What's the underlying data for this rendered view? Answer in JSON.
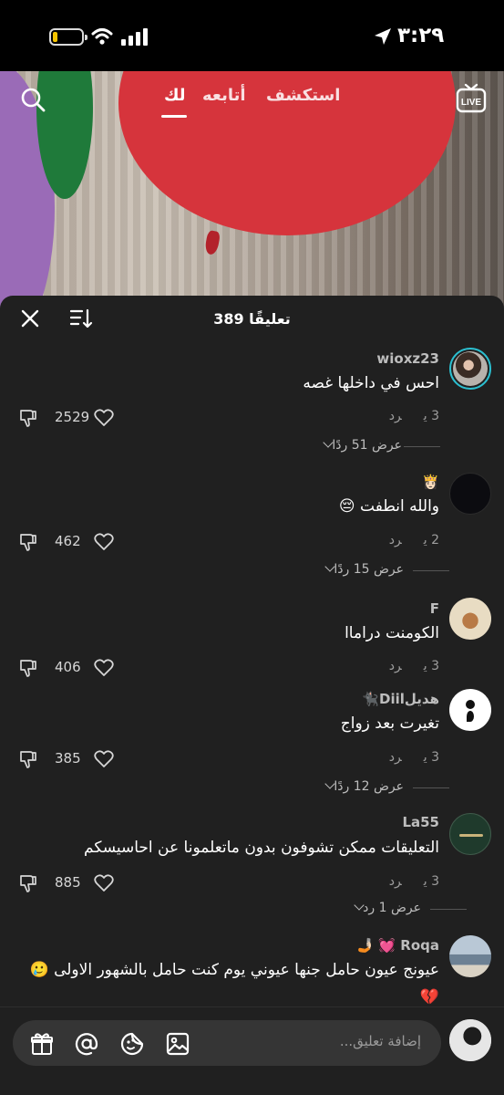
{
  "status_bar": {
    "time": "٣:٢٩",
    "battery_level": 0.15,
    "battery_color": "#f5c400",
    "icons": [
      "battery-icon",
      "wifi-icon",
      "signal-icon",
      "location-arrow-icon"
    ]
  },
  "top_nav": {
    "tabs": [
      {
        "label": "استكشف",
        "active": false
      },
      {
        "label": "أتابعه",
        "active": false
      },
      {
        "label": "لك",
        "active": true
      }
    ],
    "search_icon": "search-icon",
    "live_icon": "LIVE"
  },
  "comments_sheet": {
    "title": "389 تعليقًا",
    "close_icon": "close-icon",
    "sort_icon": "sort-icon",
    "comments": [
      {
        "username": "wioxz23",
        "text": "احس في داخلها غصه",
        "time": "3 ي",
        "reply_label": "رد",
        "likes": "2529",
        "replies_label": "عرض 51 ردًا",
        "avatar_color": "#6a5f56"
      },
      {
        "username": "👸🏻",
        "text": "والله انطفت 😔",
        "time": "2 ي",
        "reply_label": "رد",
        "likes": "462",
        "replies_label": "عرض 15 ردًا",
        "avatar_color": "#0c0c10"
      },
      {
        "username": "F",
        "text": "الكومنت دراماا",
        "time": "3 ي",
        "reply_label": "رد",
        "likes": "406",
        "replies_label": "",
        "avatar_color": "#d8c7a4"
      },
      {
        "username": "هديلDiil🐈‍⬛",
        "text": "تغيرت بعد زواج",
        "time": "3 ي",
        "reply_label": "رد",
        "likes": "385",
        "replies_label": "عرض 12 ردًا",
        "avatar_color": "#ffffff"
      },
      {
        "username": "La55",
        "text": "التعليقات ممكن تشوفون بدون ماتعلمونا عن احاسيسكم",
        "time": "3 ي",
        "reply_label": "رد",
        "likes": "885",
        "replies_label": "عرض 1 رد",
        "avatar_color": "#1f3a2c"
      },
      {
        "username": "Roqa 💓 🤳🏻",
        "text": "عيونج عيون حامل جنها عيوني يوم كنت حامل بالشهور الاولى 🥲💔",
        "avatar_color": "#8fa3b5"
      }
    ]
  },
  "input_bar": {
    "placeholder": "إضافة تعليق...",
    "icons": [
      "gift-icon",
      "mention-icon",
      "emoji-icon",
      "image-icon"
    ]
  },
  "colors": {
    "sheet_bg": "#202020",
    "input_bg": "#353535",
    "muted_text": "#9e9e9e"
  }
}
